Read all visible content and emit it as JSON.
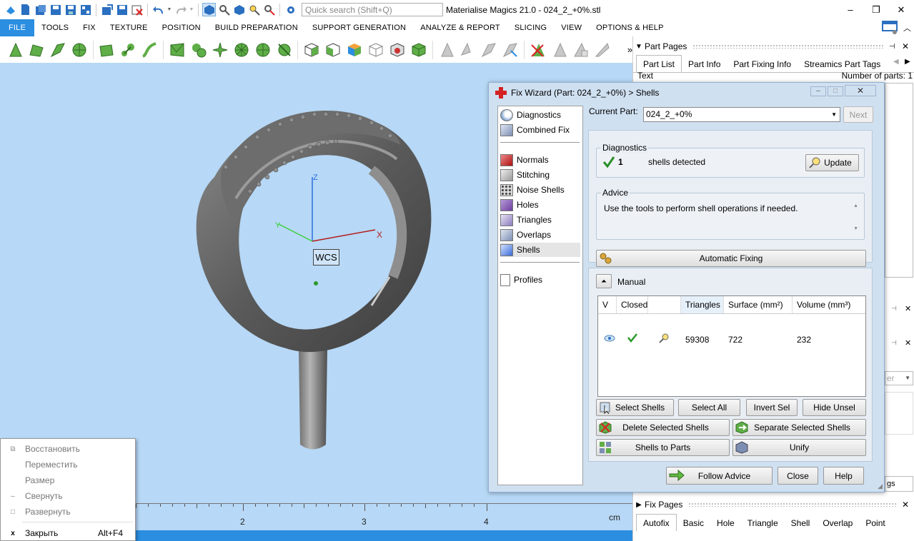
{
  "app": {
    "title": "Materialise Magics 21.0 - 024_2_+0%.stl",
    "search_placeholder": "Quick search (Shift+Q)"
  },
  "quick_access": [
    "new-icon",
    "new-project-icon",
    "import-icon",
    "save-icon",
    "save-all-icon",
    "export-icon",
    "save-part-icon",
    "close-part-icon",
    "undo-icon",
    "redo-icon",
    "select-icon",
    "zoom-icon",
    "view-icon",
    "find-icon",
    "deselect-icon",
    "settings-icon"
  ],
  "window_controls": {
    "minimize": "–",
    "restore": "❐",
    "close": "✕"
  },
  "menu": [
    "FILE",
    "TOOLS",
    "FIX",
    "TEXTURE",
    "POSITION",
    "BUILD PREPARATION",
    "SUPPORT GENERATION",
    "ANALYZE & REPORT",
    "SLICING",
    "VIEW",
    "OPTIONS & HELP"
  ],
  "viewport": {
    "wcs_label": "WCS",
    "axis_z": "Z",
    "axis_y": "Y",
    "axis_x": "X",
    "ruler": {
      "labels": [
        "2",
        "3",
        "4"
      ],
      "unit": "cm"
    }
  },
  "system_menu": [
    {
      "icon": "⧉",
      "label": "Восстановить",
      "shortcut": "",
      "disabled": true
    },
    {
      "icon": "",
      "label": "Переместить",
      "shortcut": "",
      "disabled": true
    },
    {
      "icon": "",
      "label": "Размер",
      "shortcut": "",
      "disabled": true
    },
    {
      "icon": "–",
      "label": "Свернуть",
      "shortcut": "",
      "disabled": true
    },
    {
      "icon": "□",
      "label": "Развернуть",
      "shortcut": "",
      "disabled": true
    },
    {
      "icon": "x",
      "label": "Закрыть",
      "shortcut": "Alt+F4",
      "disabled": false
    }
  ],
  "part_pages": {
    "title": "Part Pages",
    "tabs": [
      "Part List",
      "Part Info",
      "Part Fixing Info",
      "Streamics Part Tags"
    ],
    "text_label": "Text",
    "num_parts": "Number of parts: 1",
    "hidden_dropdown_fragment": "er",
    "hidden_tab_fragment": "gs"
  },
  "fix_pages": {
    "title": "Fix Pages",
    "tabs": [
      "Autofix",
      "Basic",
      "Hole",
      "Triangle",
      "Shell",
      "Overlap",
      "Point"
    ]
  },
  "fix_wizard": {
    "title": "Fix Wizard (Part: 024_2_+0%) > Shells",
    "nav_top": [
      "Diagnostics",
      "Combined Fix"
    ],
    "nav_mid": [
      "Normals",
      "Stitching",
      "Noise Shells",
      "Holes",
      "Triangles",
      "Overlaps",
      "Shells"
    ],
    "nav_bottom": [
      "Profiles"
    ],
    "selected_nav": "Shells",
    "current_part_label": "Current Part:",
    "current_part": "024_2_+0%",
    "next_label": "Next",
    "diagnostics": {
      "title": "Diagnostics",
      "count": "1",
      "text": "shells detected",
      "update": "Update"
    },
    "advice": {
      "title": "Advice",
      "text": "Use the tools to perform shell operations if needed."
    },
    "automatic_fixing": "Automatic Fixing",
    "manual_label": "Manual",
    "table": {
      "columns": [
        "V",
        "Closed",
        "",
        "Triangles",
        "Surface (mm²)",
        "Volume (mm³)"
      ],
      "rows": [
        {
          "triangles": "59308",
          "surface": "722",
          "volume": "232"
        }
      ]
    },
    "buttons": {
      "select_shells": "Select Shells",
      "select_all": "Select All",
      "invert_sel": "Invert Sel",
      "hide_unsel": "Hide Unsel",
      "delete_selected": "Delete Selected Shells",
      "separate_selected": "Separate Selected Shells",
      "shells_to_parts": "Shells to Parts",
      "unify": "Unify",
      "follow_advice": "Follow Advice",
      "close": "Close",
      "help": "Help"
    }
  },
  "colors": {
    "accent": "#2b8ee0",
    "viewport_bg": "#b7d8f6",
    "toolbar_green": "#5fae48",
    "dialog_bg": "#cfe0f1",
    "check_green": "#2aa02a"
  }
}
